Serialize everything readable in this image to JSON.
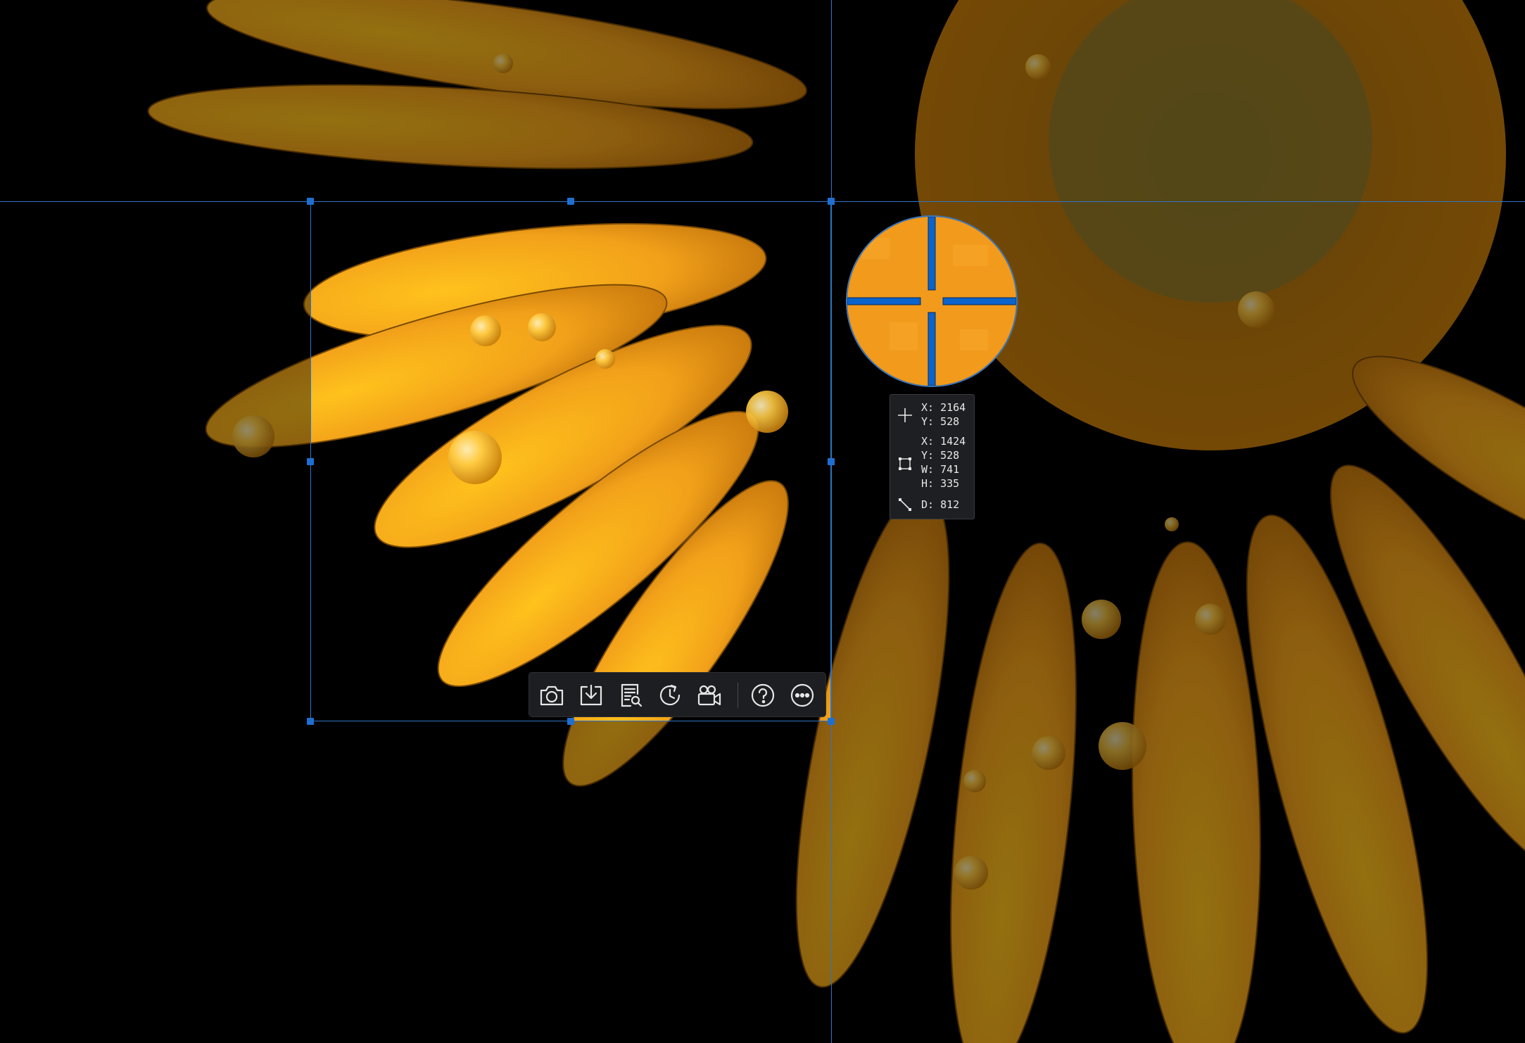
{
  "colors": {
    "accent": "#1f6fd1",
    "guide": "#2f74c8",
    "toolbar_bg": "#1d1e21",
    "icon": "#e6e6e6",
    "petal": "#f2a11a",
    "magnifier_fill": "#f29a1c"
  },
  "info_panel": {
    "cursor": {
      "x_label": "X:",
      "x_value": "2164",
      "y_label": "Y:",
      "y_value": "528"
    },
    "selection": {
      "x_label": "X:",
      "x_value": "1424",
      "y_label": "Y:",
      "y_value": "528",
      "w_label": "W:",
      "w_value": "741",
      "h_label": "H:",
      "h_value": "335"
    },
    "distance": {
      "d_label": "D:",
      "d_value": "812"
    },
    "icons": [
      "crosshair-icon",
      "selection-rect-icon",
      "diagonal-measure-icon"
    ]
  },
  "toolbar": {
    "buttons": [
      {
        "name": "capture-button",
        "icon": "camera-icon"
      },
      {
        "name": "save-button",
        "icon": "download-tray-icon"
      },
      {
        "name": "ocr-button",
        "icon": "document-search-icon"
      },
      {
        "name": "scrolling-capture-button",
        "icon": "clock-refresh-icon"
      },
      {
        "name": "record-video-button",
        "icon": "video-camera-icon"
      },
      {
        "name": "help-button",
        "icon": "question-circle-icon"
      },
      {
        "name": "more-button",
        "icon": "more-dots-icon"
      }
    ]
  }
}
